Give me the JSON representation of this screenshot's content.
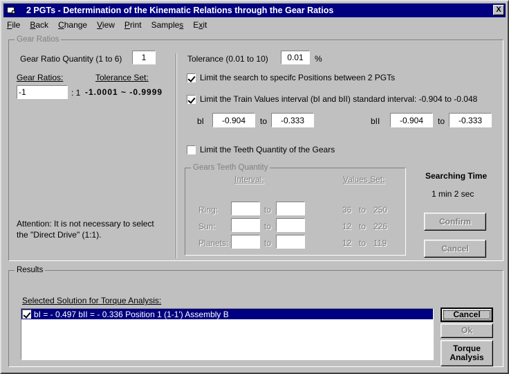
{
  "window": {
    "title": "2 PGTs - Determination of the Kinematic Relations through the Gear Ratios",
    "close_label": "X",
    "icon": "document-icon",
    "titlebar_color": "#000080"
  },
  "menu": {
    "items": [
      {
        "label": "File"
      },
      {
        "label": "Back"
      },
      {
        "label": "Change"
      },
      {
        "label": "View"
      },
      {
        "label": "Print"
      },
      {
        "label": "Samples"
      },
      {
        "label": "Exit"
      }
    ]
  },
  "gear_ratios_group": {
    "legend": "Gear Ratios",
    "quantity_label": "Gear Ratio Quantity (1 to 6)",
    "quantity_value": "1",
    "ratios_header": "Gear Ratios:",
    "tolerance_set_header": "Tolerance Set:",
    "ratio_value": "-1",
    "ratio_suffix": ": 1",
    "tolerance_set_value": "-1.0001 ~ -0.9999",
    "attention_line1": "Attention: It is not necessary to select",
    "attention_line2": "the \"Direct Drive\" (1:1)."
  },
  "tolerance": {
    "label": "Tolerance  (0.01 to 10)",
    "value": "0.01",
    "unit": "%"
  },
  "options": {
    "limit_positions": {
      "label": "Limit the search to specifc Positions between 2 PGTs",
      "checked": true
    },
    "limit_train_values": {
      "label": "Limit the Train Values interval  (bI and bII) standard interval: -0.904  to  -0.048",
      "checked": true
    },
    "limit_teeth": {
      "label": "Limit the Teeth Quantity of the Gears",
      "checked": false
    }
  },
  "train_values": {
    "bI_label": "bI",
    "bI_from": "-0.904",
    "bI_to_label": "to",
    "bI_to": "-0.333",
    "bII_label": "bII",
    "bII_from": "-0.904",
    "bII_to_label": "to",
    "bII_to": "-0.333"
  },
  "teeth_group": {
    "legend": "Gears Teeth Quantity",
    "interval_header": "Interval:",
    "values_set_header": "Values Set:",
    "to_label": "to",
    "rows": [
      {
        "name": "Ring:",
        "from": "",
        "to": "",
        "set_from": "36",
        "set_to": "250"
      },
      {
        "name": "Sun:",
        "from": "",
        "to": "",
        "set_from": "12",
        "set_to": "226"
      },
      {
        "name": "Planets:",
        "from": "",
        "to": "",
        "set_from": "12",
        "set_to": "119"
      }
    ]
  },
  "searching": {
    "title": "Searching  Time",
    "time": "1 min  2 sec",
    "confirm_label": "Confirm",
    "cancel_label": "Cancel"
  },
  "results": {
    "legend": "Results",
    "selected_label": "Selected Solution for Torque Analysis:",
    "items": [
      {
        "checked": true,
        "text": "bI = - 0.497   bII = - 0.336    Position 1 (1-1')    Assembly B"
      }
    ],
    "cancel_label": "Cancel",
    "ok_label": "Ok",
    "torque_line1": "Torque",
    "torque_line2": "Analysis",
    "highlight_color": "#000080"
  }
}
